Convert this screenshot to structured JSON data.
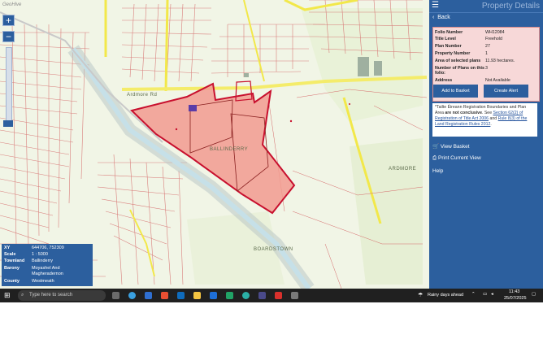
{
  "map": {
    "brand": "GeoHive",
    "zoom_in": "+",
    "zoom_out": "−",
    "labels": {
      "road": "Ardmore Rd",
      "townland": "BALLINDERRY",
      "ardmore": "ARDMORE",
      "boardstown": "BOARDSTOWN"
    }
  },
  "infobox": {
    "rows": [
      {
        "key": "XY",
        "value": "644706, 752309"
      },
      {
        "key": "Scale",
        "value": "1 : 5000"
      },
      {
        "key": "Townland",
        "value": "Ballinderry"
      },
      {
        "key": "Barony",
        "value": "Moyashel And Magheradernon"
      },
      {
        "key": "County",
        "value": "Westmeath"
      }
    ]
  },
  "sidebar": {
    "title": "Property Details",
    "back": "Back",
    "details": [
      {
        "key": "Folio Number",
        "value": "WH12084"
      },
      {
        "key": "Title Level",
        "value": "Freehold"
      },
      {
        "key": "Plan Number",
        "value": "27"
      },
      {
        "key": "Property Number",
        "value": "1"
      },
      {
        "key": "Area of selected plans",
        "value": "11.93 hectares."
      },
      {
        "key": "Number of Plans on this folio:",
        "value": "3"
      },
      {
        "key": "Address",
        "value": "Not Available"
      }
    ],
    "add_basket": "Add to Basket",
    "create_alert": "Create Alert",
    "notice": {
      "p1": "*Tailte Éireann Registration Boundaries and Plan Area ",
      "bold": "are not conclusive",
      "p2": ". See ",
      "link1": "Section 62(2) of Registration of Title Act 2006",
      "p3": " and ",
      "link2": "Rule 8(3) of the Land Registration Rules 2012",
      "p4": "."
    },
    "view_basket": "View Basket",
    "print_view": "Print Current View",
    "help": "Help"
  },
  "taskbar": {
    "search_placeholder": "Type here to search",
    "weather": "Rainy days ahead",
    "time": "11:43",
    "date": "25/07/2025"
  }
}
